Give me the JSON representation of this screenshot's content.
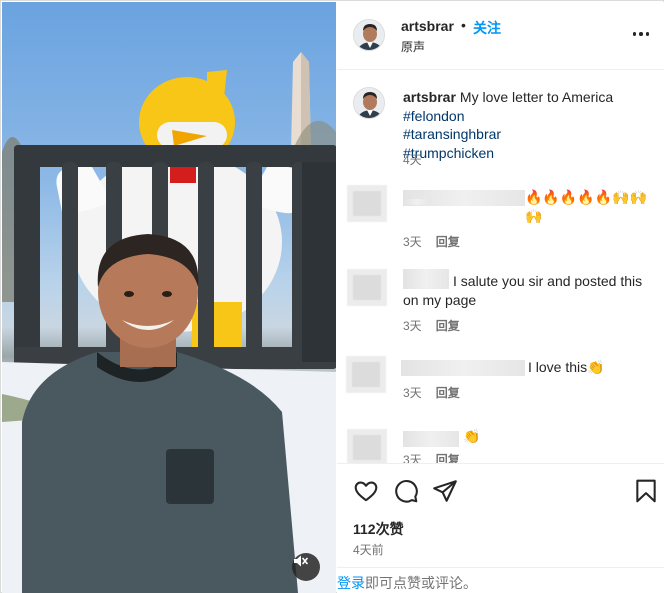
{
  "colors": {
    "accent": "#0095f6",
    "hashtag": "#00376b",
    "muted": "#737373",
    "text": "#262626"
  },
  "media": {
    "mute_icon": "speaker-muted-icon"
  },
  "post_header": {
    "username": "artsbrar",
    "separator": "•",
    "follow_label": "关注",
    "audio_label": "原声",
    "more_icon": "more-horizontal-icon"
  },
  "caption": {
    "username": "artsbrar",
    "text": "My love letter to America",
    "hashtags": [
      "#felondon",
      "#taransinghbrar",
      "#trumpchicken"
    ],
    "time": "4天"
  },
  "comments": [
    {
      "text": "🔥🔥🔥🔥🔥🙌🙌 🙌",
      "time": "3天",
      "reply_label": "回复"
    },
    {
      "text": "I salute you sir and posted this on my page",
      "time": "3天",
      "reply_label": "回复"
    },
    {
      "text": "I love this👏",
      "time": "3天",
      "reply_label": "回复"
    },
    {
      "text": "👏",
      "time": "3天",
      "reply_label": "回复"
    }
  ],
  "actions": {
    "like_icon": "heart-icon",
    "comment_icon": "comment-icon",
    "share_icon": "send-icon",
    "save_icon": "bookmark-icon",
    "likes_text": "112次赞",
    "date_text": "4天前"
  },
  "login_prompt": {
    "link_label": "登录",
    "text": "即可点赞或评论。"
  }
}
